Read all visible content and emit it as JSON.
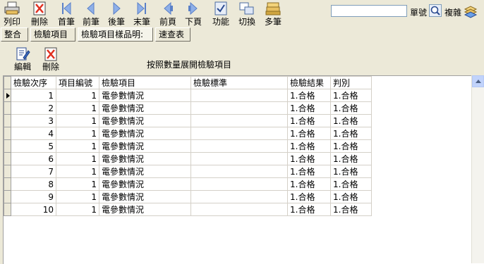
{
  "toolbar": {
    "items": [
      {
        "label": "列印",
        "icon": "printer-icon"
      },
      {
        "label": "刪除",
        "icon": "delete-icon"
      },
      {
        "label": "首筆",
        "icon": "first-record-icon"
      },
      {
        "label": "前筆",
        "icon": "previous-record-icon"
      },
      {
        "label": "後筆",
        "icon": "next-record-icon"
      },
      {
        "label": "末筆",
        "icon": "last-record-icon"
      },
      {
        "label": "前頁",
        "icon": "previous-page-icon"
      },
      {
        "label": "下頁",
        "icon": "next-page-icon"
      },
      {
        "label": "功能",
        "icon": "function-icon"
      },
      {
        "label": "切換",
        "icon": "switch-icon"
      },
      {
        "label": "多筆",
        "icon": "multi-record-icon"
      }
    ],
    "search_value": "",
    "search_label": "單號",
    "copy_label": "複雜"
  },
  "tabs": [
    "整合",
    "檢驗項目",
    "檢驗項目樣品明:",
    "速查表"
  ],
  "actions": {
    "edit_label": "編輯",
    "delete_label": "刪除"
  },
  "caption": "按照數量展開檢驗項目",
  "grid": {
    "headers": [
      "檢驗次序",
      "項目編號",
      "檢驗項目",
      "檢驗標準",
      "檢驗結果",
      "判別"
    ],
    "rows": [
      [
        "1",
        "1",
        "電參數情況",
        "",
        "1.合格",
        "1.合格"
      ],
      [
        "2",
        "1",
        "電參數情況",
        "",
        "1.合格",
        "1.合格"
      ],
      [
        "3",
        "1",
        "電參數情況",
        "",
        "1.合格",
        "1.合格"
      ],
      [
        "4",
        "1",
        "電參數情況",
        "",
        "1.合格",
        "1.合格"
      ],
      [
        "5",
        "1",
        "電參數情況",
        "",
        "1.合格",
        "1.合格"
      ],
      [
        "6",
        "1",
        "電參數情況",
        "",
        "1.合格",
        "1.合格"
      ],
      [
        "7",
        "1",
        "電參數情況",
        "",
        "1.合格",
        "1.合格"
      ],
      [
        "8",
        "1",
        "電參數情況",
        "",
        "1.合格",
        "1.合格"
      ],
      [
        "9",
        "1",
        "電參數情況",
        "",
        "1.合格",
        "1.合格"
      ],
      [
        "10",
        "1",
        "電參數情況",
        "",
        "1.合格",
        "1.合格"
      ]
    ]
  }
}
